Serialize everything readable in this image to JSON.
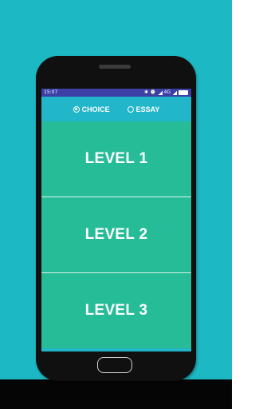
{
  "status_bar": {
    "time": "15:07",
    "network": "4G"
  },
  "mode": {
    "options": [
      {
        "label": "CHOICE",
        "selected": true
      },
      {
        "label": "ESSAY",
        "selected": false
      }
    ]
  },
  "levels": [
    {
      "label": "LEVEL 1"
    },
    {
      "label": "LEVEL 2"
    },
    {
      "label": "LEVEL 3"
    }
  ],
  "colors": {
    "backdrop": "#1cb8c4",
    "status_bar": "#3b3fa6",
    "header": "#21b6c9",
    "level_tile": "#26bc98"
  }
}
